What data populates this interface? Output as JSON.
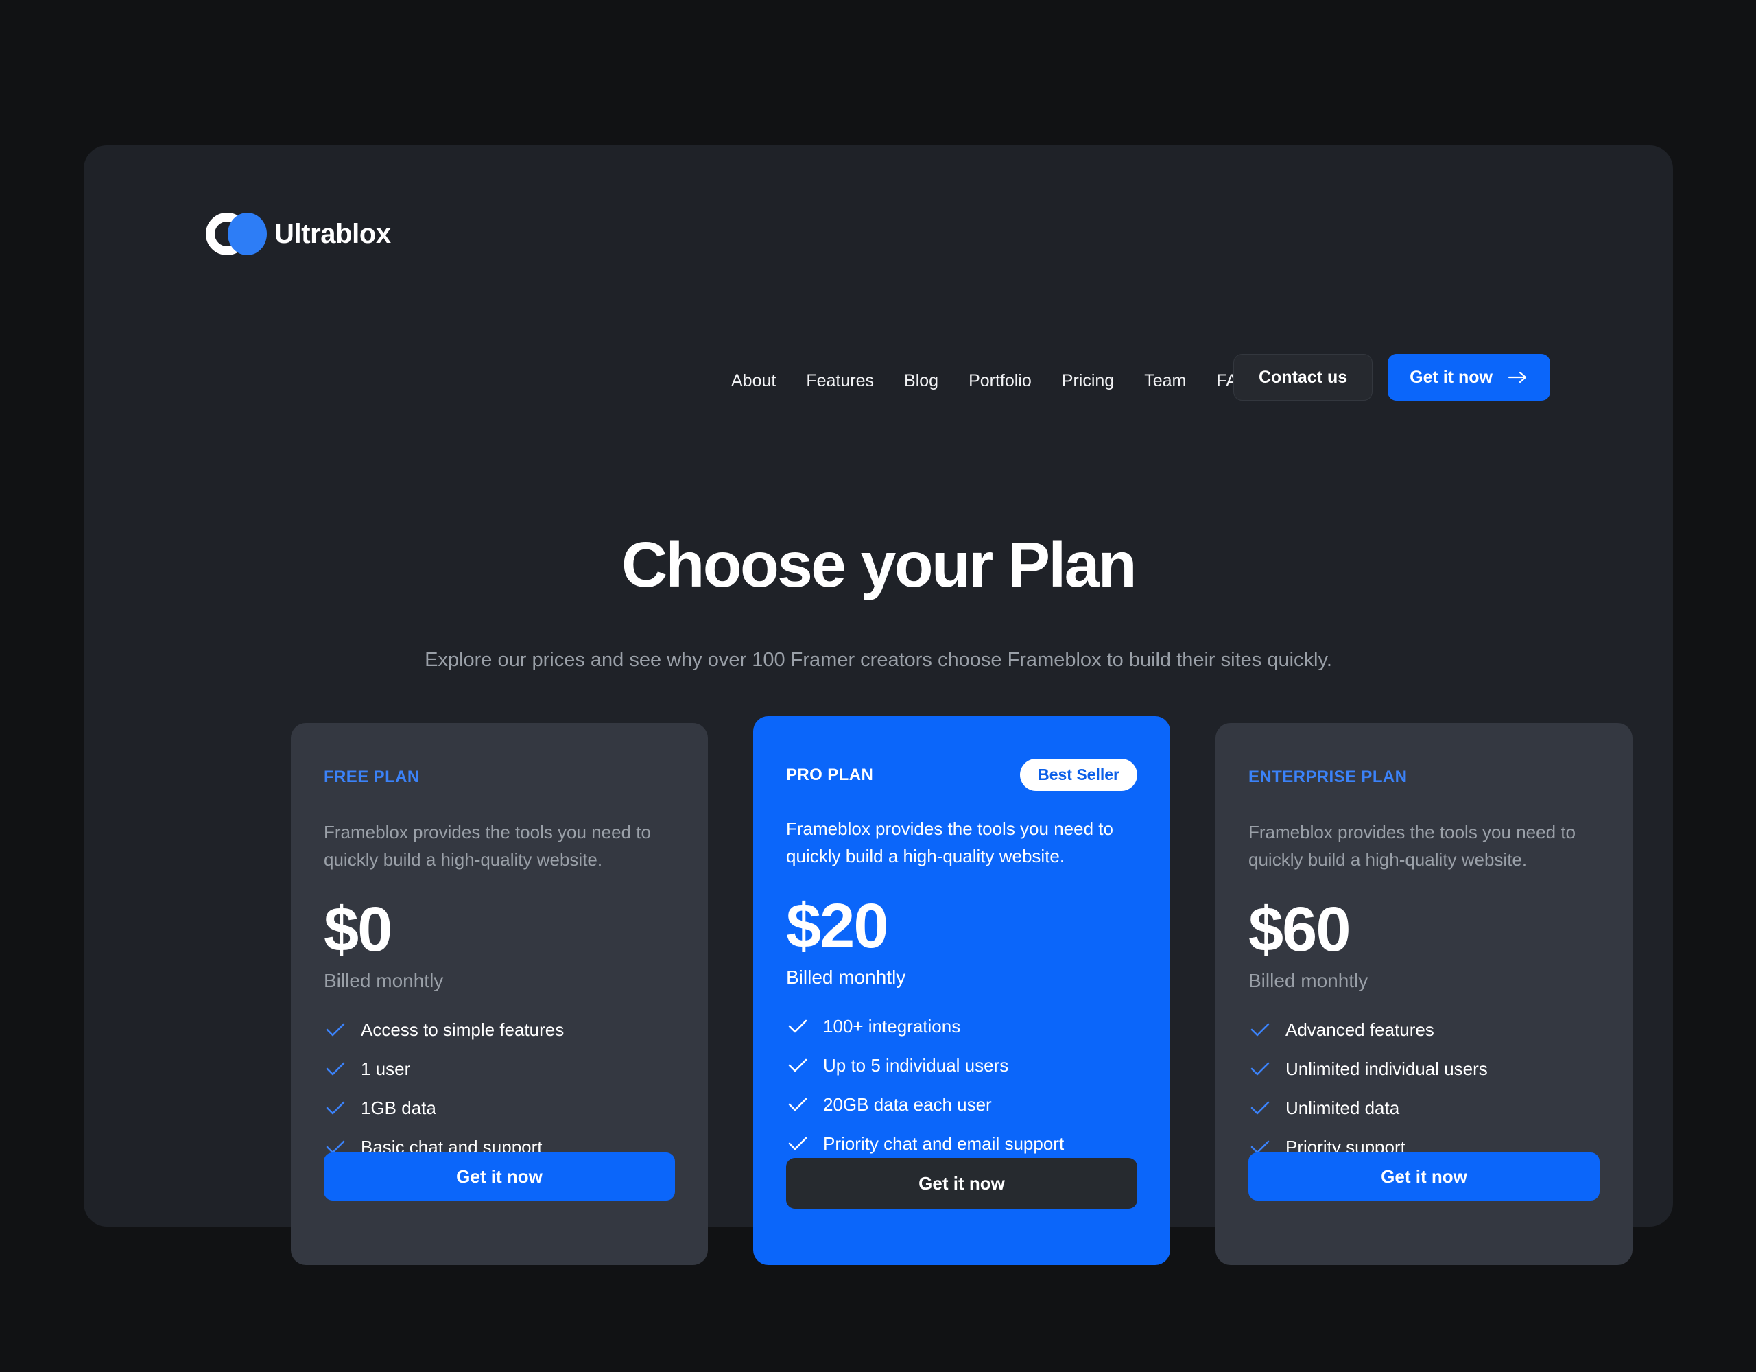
{
  "theme": {
    "page_background": "#111214",
    "panel_background": "#1f2228",
    "accent_blue": "#0b66fa",
    "card_background": "#343841",
    "muted_text": "#9aa0a8",
    "dark_button": "#262a2f"
  },
  "header": {
    "brand": {
      "name": "Ultrablox",
      "ring_icon": "brand-ring-icon",
      "dot_icon": "brand-circle-icon"
    },
    "nav": [
      {
        "label": "About"
      },
      {
        "label": "Features"
      },
      {
        "label": "Blog"
      },
      {
        "label": "Portfolio"
      },
      {
        "label": "Pricing"
      },
      {
        "label": "Team"
      },
      {
        "label": "FAQ"
      }
    ],
    "contact_button": "Contact us",
    "cta_button": "Get it now",
    "cta_icon": "arrow-right-icon"
  },
  "hero": {
    "title": "Choose your Plan",
    "subtitle": "Explore our prices and see why over 100 Framer creators choose Frameblox to build their sites quickly."
  },
  "plans": [
    {
      "name": "FREE PLAN",
      "badge": null,
      "description": "Frameblox provides the tools you need to quickly build a high-quality website.",
      "price": "$0",
      "billing": "Billed monhtly",
      "features": [
        "Access to simple features",
        "1 user",
        "1GB data",
        "Basic chat and support"
      ],
      "cta": "Get it now",
      "highlighted": false
    },
    {
      "name": "PRO PLAN",
      "badge": "Best Seller",
      "description": "Frameblox provides the tools you need to quickly build a high-quality website.",
      "price": "$20",
      "billing": "Billed monhtly",
      "features": [
        "100+ integrations",
        "Up to 5 individual users",
        "20GB data each user",
        "Priority chat and email support"
      ],
      "cta": "Get it now",
      "highlighted": true
    },
    {
      "name": "ENTERPRISE PLAN",
      "badge": null,
      "description": "Frameblox provides the tools you need to quickly build a high-quality website.",
      "price": "$60",
      "billing": "Billed monhtly",
      "features": [
        "Advanced features",
        "Unlimited individual users",
        "Unlimited data",
        "Priority support"
      ],
      "cta": "Get it now",
      "highlighted": false
    }
  ]
}
